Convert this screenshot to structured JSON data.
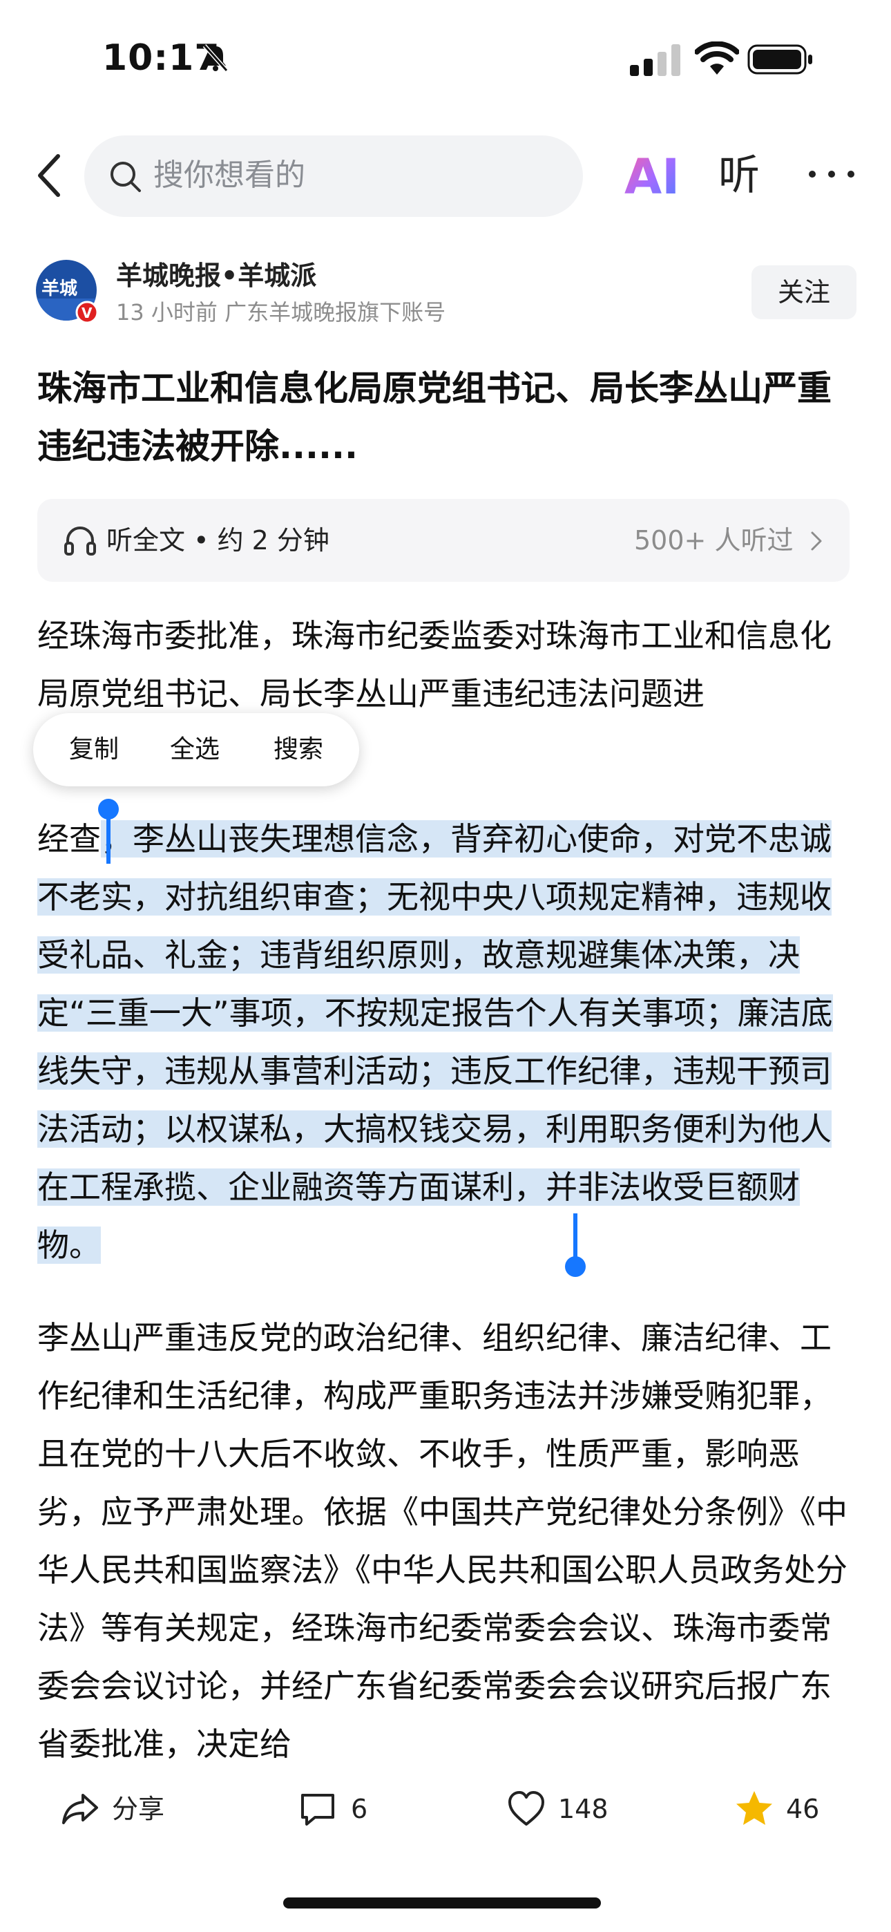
{
  "status_bar": {
    "time": "10:17"
  },
  "nav": {
    "search_placeholder": "搜你想看的",
    "ai_label": "AI",
    "listen_label": "听"
  },
  "author": {
    "name": "羊城晚报•羊城派",
    "meta": "13 小时前   广东羊城晚报旗下账号",
    "avatar_text": "羊城",
    "follow_label": "关注"
  },
  "article": {
    "title": "珠海市工业和信息化局原党组书记、局长李丛山严重违纪违法被开除......",
    "listen_bar": {
      "label": "听全文 • 约 2 分钟",
      "count": "500+ 人听过"
    },
    "paragraph1": "经珠海市委批准，珠海市纪委监委对珠海市工业和信息化局原党组书记、局长李丛山严重违纪违法问题进",
    "paragraph2_prefix": "经查",
    "paragraph2_selected": "，李丛山丧失理想信念，背弃初心使命，对党不忠诚不老实，对抗组织审查；无视中央八项规定精神，违规收受礼品、礼金；违背组织原则，故意规避集体决策，决定“三重一大”事项，不按规定报告个人有关事项；廉洁底线失守，违规从事营利活动；违反工作纪律，违规干预司法活动；以权谋私，大搞权钱交易，利用职务便利为他人在工程承揽、企业融资等方面谋利，并非法收受巨额财物。",
    "paragraph3": "李丛山严重违反党的政治纪律、组织纪律、廉洁纪律、工作纪律和生活纪律，构成严重职务违法并涉嫌受贿犯罪，且在党的十八大后不收敛、不收手，性质严重，影响恶劣，应予严肃处理。依据《中国共产党纪律处分条例》《中华人民共和国监察法》《中华人民共和国公职人员政务处分法》等有关规定，经珠海市纪委常委会会议、珠海市委常委会会议讨论，并经广东省纪委常委会会议研究后报广东省委批准，决定给"
  },
  "context_menu": {
    "copy": "复制",
    "select_all": "全选",
    "search": "搜索"
  },
  "bottom_bar": {
    "share_label": "分享",
    "comments": "6",
    "likes": "148",
    "favorites": "46"
  },
  "colors": {
    "selection": "#d6e6f6",
    "handle": "#1677ff",
    "star": "#f5b800"
  }
}
